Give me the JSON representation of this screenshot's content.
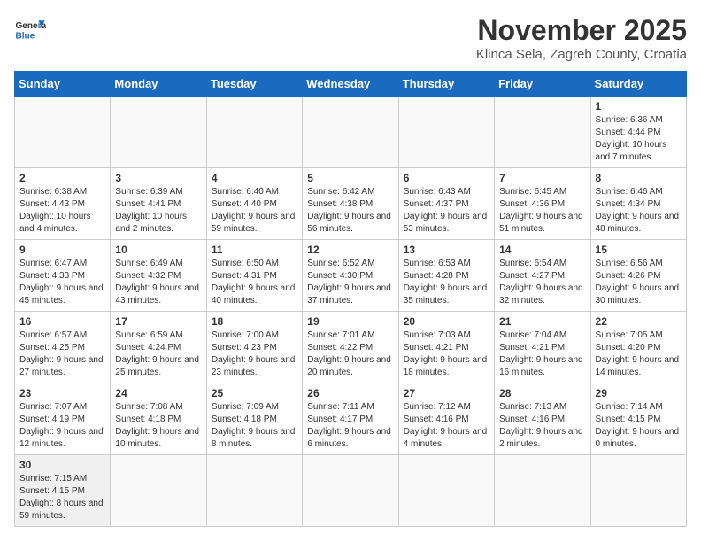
{
  "logo": {
    "text_general": "General",
    "text_blue": "Blue"
  },
  "title": "November 2025",
  "subtitle": "Klinca Sela, Zagreb County, Croatia",
  "weekdays": [
    "Sunday",
    "Monday",
    "Tuesday",
    "Wednesday",
    "Thursday",
    "Friday",
    "Saturday"
  ],
  "weeks": [
    [
      {
        "day": "",
        "info": ""
      },
      {
        "day": "",
        "info": ""
      },
      {
        "day": "",
        "info": ""
      },
      {
        "day": "",
        "info": ""
      },
      {
        "day": "",
        "info": ""
      },
      {
        "day": "",
        "info": ""
      },
      {
        "day": "1",
        "info": "Sunrise: 6:36 AM\nSunset: 4:44 PM\nDaylight: 10 hours and 7 minutes."
      }
    ],
    [
      {
        "day": "2",
        "info": "Sunrise: 6:38 AM\nSunset: 4:43 PM\nDaylight: 10 hours and 4 minutes."
      },
      {
        "day": "3",
        "info": "Sunrise: 6:39 AM\nSunset: 4:41 PM\nDaylight: 10 hours and 2 minutes."
      },
      {
        "day": "4",
        "info": "Sunrise: 6:40 AM\nSunset: 4:40 PM\nDaylight: 9 hours and 59 minutes."
      },
      {
        "day": "5",
        "info": "Sunrise: 6:42 AM\nSunset: 4:38 PM\nDaylight: 9 hours and 56 minutes."
      },
      {
        "day": "6",
        "info": "Sunrise: 6:43 AM\nSunset: 4:37 PM\nDaylight: 9 hours and 53 minutes."
      },
      {
        "day": "7",
        "info": "Sunrise: 6:45 AM\nSunset: 4:36 PM\nDaylight: 9 hours and 51 minutes."
      },
      {
        "day": "8",
        "info": "Sunrise: 6:46 AM\nSunset: 4:34 PM\nDaylight: 9 hours and 48 minutes."
      }
    ],
    [
      {
        "day": "9",
        "info": "Sunrise: 6:47 AM\nSunset: 4:33 PM\nDaylight: 9 hours and 45 minutes."
      },
      {
        "day": "10",
        "info": "Sunrise: 6:49 AM\nSunset: 4:32 PM\nDaylight: 9 hours and 43 minutes."
      },
      {
        "day": "11",
        "info": "Sunrise: 6:50 AM\nSunset: 4:31 PM\nDaylight: 9 hours and 40 minutes."
      },
      {
        "day": "12",
        "info": "Sunrise: 6:52 AM\nSunset: 4:30 PM\nDaylight: 9 hours and 37 minutes."
      },
      {
        "day": "13",
        "info": "Sunrise: 6:53 AM\nSunset: 4:28 PM\nDaylight: 9 hours and 35 minutes."
      },
      {
        "day": "14",
        "info": "Sunrise: 6:54 AM\nSunset: 4:27 PM\nDaylight: 9 hours and 32 minutes."
      },
      {
        "day": "15",
        "info": "Sunrise: 6:56 AM\nSunset: 4:26 PM\nDaylight: 9 hours and 30 minutes."
      }
    ],
    [
      {
        "day": "16",
        "info": "Sunrise: 6:57 AM\nSunset: 4:25 PM\nDaylight: 9 hours and 27 minutes."
      },
      {
        "day": "17",
        "info": "Sunrise: 6:59 AM\nSunset: 4:24 PM\nDaylight: 9 hours and 25 minutes."
      },
      {
        "day": "18",
        "info": "Sunrise: 7:00 AM\nSunset: 4:23 PM\nDaylight: 9 hours and 23 minutes."
      },
      {
        "day": "19",
        "info": "Sunrise: 7:01 AM\nSunset: 4:22 PM\nDaylight: 9 hours and 20 minutes."
      },
      {
        "day": "20",
        "info": "Sunrise: 7:03 AM\nSunset: 4:21 PM\nDaylight: 9 hours and 18 minutes."
      },
      {
        "day": "21",
        "info": "Sunrise: 7:04 AM\nSunset: 4:21 PM\nDaylight: 9 hours and 16 minutes."
      },
      {
        "day": "22",
        "info": "Sunrise: 7:05 AM\nSunset: 4:20 PM\nDaylight: 9 hours and 14 minutes."
      }
    ],
    [
      {
        "day": "23",
        "info": "Sunrise: 7:07 AM\nSunset: 4:19 PM\nDaylight: 9 hours and 12 minutes."
      },
      {
        "day": "24",
        "info": "Sunrise: 7:08 AM\nSunset: 4:18 PM\nDaylight: 9 hours and 10 minutes."
      },
      {
        "day": "25",
        "info": "Sunrise: 7:09 AM\nSunset: 4:18 PM\nDaylight: 9 hours and 8 minutes."
      },
      {
        "day": "26",
        "info": "Sunrise: 7:11 AM\nSunset: 4:17 PM\nDaylight: 9 hours and 6 minutes."
      },
      {
        "day": "27",
        "info": "Sunrise: 7:12 AM\nSunset: 4:16 PM\nDaylight: 9 hours and 4 minutes."
      },
      {
        "day": "28",
        "info": "Sunrise: 7:13 AM\nSunset: 4:16 PM\nDaylight: 9 hours and 2 minutes."
      },
      {
        "day": "29",
        "info": "Sunrise: 7:14 AM\nSunset: 4:15 PM\nDaylight: 9 hours and 0 minutes."
      }
    ],
    [
      {
        "day": "30",
        "info": "Sunrise: 7:15 AM\nSunset: 4:15 PM\nDaylight: 8 hours and 59 minutes."
      },
      {
        "day": "",
        "info": ""
      },
      {
        "day": "",
        "info": ""
      },
      {
        "day": "",
        "info": ""
      },
      {
        "day": "",
        "info": ""
      },
      {
        "day": "",
        "info": ""
      },
      {
        "day": "",
        "info": ""
      }
    ]
  ]
}
